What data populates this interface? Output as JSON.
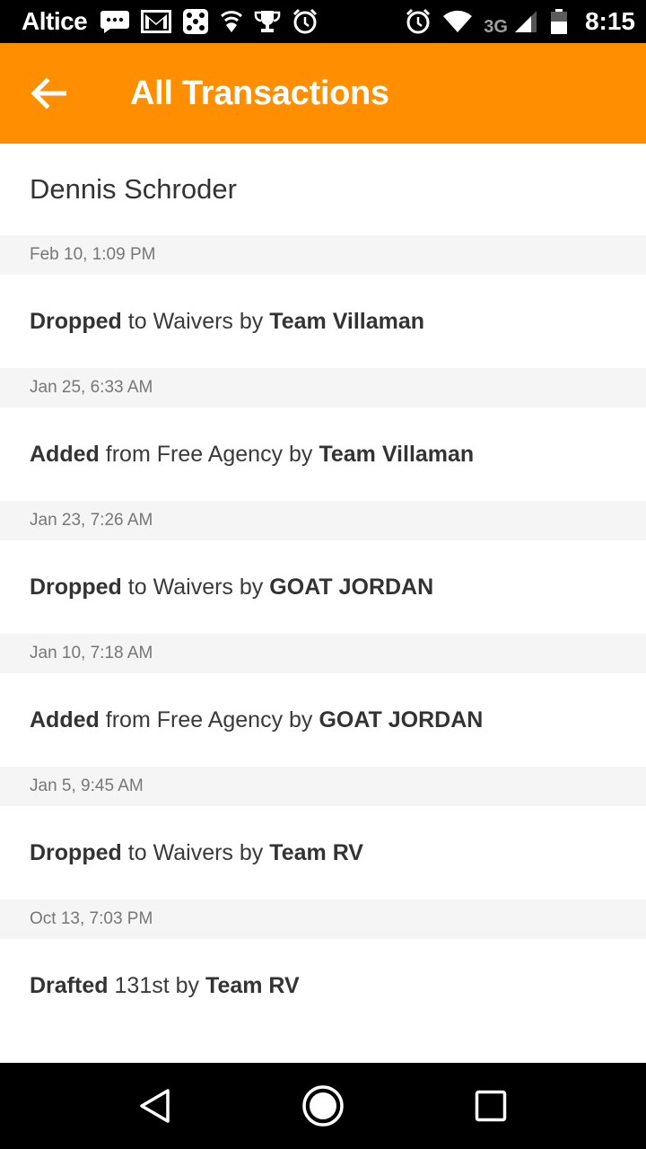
{
  "status_bar": {
    "carrier": "Altice",
    "network_type": "3G",
    "time": "8:15",
    "icons": [
      "chat-icon",
      "gmail-icon",
      "dice-icon",
      "vpn-shield-icon",
      "trophy-icon",
      "alarm-icon",
      "alarm-icon",
      "wifi-icon",
      "cell-signal-icon",
      "battery-icon"
    ]
  },
  "app_bar": {
    "title": "All Transactions",
    "back_icon": "arrow-back-icon",
    "background_color": "#ff8f00"
  },
  "player": {
    "name": "Dennis Schroder"
  },
  "transactions": [
    {
      "date": "Feb 10, 1:09 PM",
      "action": "Dropped",
      "detail": "to Waivers by",
      "team": "Team Villaman"
    },
    {
      "date": "Jan 25, 6:33 AM",
      "action": "Added",
      "detail": "from Free Agency by",
      "team": "Team Villaman"
    },
    {
      "date": "Jan 23, 7:26 AM",
      "action": "Dropped",
      "detail": "to Waivers by",
      "team": "GOAT JORDAN"
    },
    {
      "date": "Jan 10, 7:18 AM",
      "action": "Added",
      "detail": "from Free Agency by",
      "team": "GOAT JORDAN"
    },
    {
      "date": "Jan 5, 9:45 AM",
      "action": "Dropped",
      "detail": "to Waivers by",
      "team": "Team RV"
    },
    {
      "date": "Oct 13, 7:03 PM",
      "action": "Drafted",
      "detail": "131st by",
      "team": "Team RV"
    }
  ],
  "nav_bar": {
    "buttons": [
      "back-triangle-icon",
      "home-circle-icon",
      "recents-square-icon"
    ]
  }
}
